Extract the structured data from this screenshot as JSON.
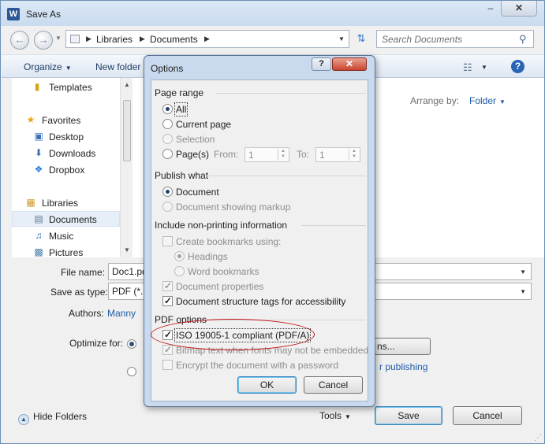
{
  "window": {
    "title": "Save As",
    "app_icon_letter": "W",
    "minimize": "–",
    "close": "✕"
  },
  "nav": {
    "breadcrumb": [
      "Libraries",
      "Documents"
    ],
    "search_placeholder": "Search Documents"
  },
  "toolbar": {
    "organize": "Organize",
    "new_folder": "New folder",
    "help": "?"
  },
  "sidebar": {
    "items": [
      {
        "label": "Templates",
        "icon": "folder-icon"
      },
      {
        "label": "Favorites",
        "icon": "star-icon"
      },
      {
        "label": "Desktop",
        "icon": "desktop-icon"
      },
      {
        "label": "Downloads",
        "icon": "downloads-icon"
      },
      {
        "label": "Dropbox",
        "icon": "dropbox-icon"
      },
      {
        "label": "Libraries",
        "icon": "library-icon"
      },
      {
        "label": "Documents",
        "icon": "documents-icon",
        "selected": true
      },
      {
        "label": "Music",
        "icon": "music-icon"
      },
      {
        "label": "Pictures",
        "icon": "pictures-icon"
      }
    ]
  },
  "filepane": {
    "arrange_label": "Arrange by:",
    "arrange_value": "Folder"
  },
  "form": {
    "file_name_label": "File name:",
    "file_name_value": "Doc1.pd",
    "save_as_type_label": "Save as type:",
    "save_as_type_value": "PDF (*.p",
    "authors_label": "Authors:",
    "authors_value": "Manny",
    "optimize_label": "Optimize for:",
    "options_button": "ns...",
    "publishing_text": "r publishing"
  },
  "footer": {
    "hide_folders": "Hide Folders",
    "tools": "Tools",
    "save": "Save",
    "cancel": "Cancel"
  },
  "options_dialog": {
    "title": "Options",
    "help": "?",
    "close": "✕",
    "page_range": {
      "heading": "Page range",
      "all": "All",
      "current_page": "Current page",
      "selection": "Selection",
      "pages": "Page(s)",
      "from_label": "From:",
      "from_value": "1",
      "to_label": "To:",
      "to_value": "1"
    },
    "publish_what": {
      "heading": "Publish what",
      "document": "Document",
      "document_markup": "Document showing markup"
    },
    "non_printing": {
      "heading": "Include non-printing information",
      "create_bookmarks": "Create bookmarks using:",
      "headings": "Headings",
      "word_bookmarks": "Word bookmarks",
      "document_properties": "Document properties",
      "structure_tags": "Document structure tags for accessibility"
    },
    "pdf_options": {
      "heading": "PDF options",
      "iso": "ISO 19005-1 compliant (PDF/A)",
      "bitmap": "Bitmap text when fonts may not be embedded",
      "encrypt": "Encrypt the document with a password"
    },
    "ok": "OK",
    "cancel": "Cancel"
  },
  "colors": {
    "link_blue": "#1e5ba8",
    "highlight_red": "#c0161b",
    "dialog_frame": "#c9daee"
  }
}
